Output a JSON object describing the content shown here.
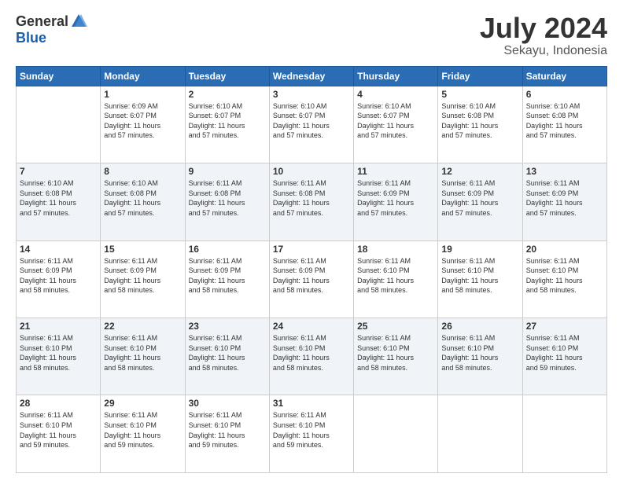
{
  "header": {
    "logo_general": "General",
    "logo_blue": "Blue",
    "month": "July 2024",
    "location": "Sekayu, Indonesia"
  },
  "days_of_week": [
    "Sunday",
    "Monday",
    "Tuesday",
    "Wednesday",
    "Thursday",
    "Friday",
    "Saturday"
  ],
  "weeks": [
    [
      {
        "day": "",
        "info": ""
      },
      {
        "day": "1",
        "info": "Sunrise: 6:09 AM\nSunset: 6:07 PM\nDaylight: 11 hours\nand 57 minutes."
      },
      {
        "day": "2",
        "info": "Sunrise: 6:10 AM\nSunset: 6:07 PM\nDaylight: 11 hours\nand 57 minutes."
      },
      {
        "day": "3",
        "info": "Sunrise: 6:10 AM\nSunset: 6:07 PM\nDaylight: 11 hours\nand 57 minutes."
      },
      {
        "day": "4",
        "info": "Sunrise: 6:10 AM\nSunset: 6:07 PM\nDaylight: 11 hours\nand 57 minutes."
      },
      {
        "day": "5",
        "info": "Sunrise: 6:10 AM\nSunset: 6:08 PM\nDaylight: 11 hours\nand 57 minutes."
      },
      {
        "day": "6",
        "info": "Sunrise: 6:10 AM\nSunset: 6:08 PM\nDaylight: 11 hours\nand 57 minutes."
      }
    ],
    [
      {
        "day": "7",
        "info": "Sunrise: 6:10 AM\nSunset: 6:08 PM\nDaylight: 11 hours\nand 57 minutes."
      },
      {
        "day": "8",
        "info": "Sunrise: 6:10 AM\nSunset: 6:08 PM\nDaylight: 11 hours\nand 57 minutes."
      },
      {
        "day": "9",
        "info": "Sunrise: 6:11 AM\nSunset: 6:08 PM\nDaylight: 11 hours\nand 57 minutes."
      },
      {
        "day": "10",
        "info": "Sunrise: 6:11 AM\nSunset: 6:08 PM\nDaylight: 11 hours\nand 57 minutes."
      },
      {
        "day": "11",
        "info": "Sunrise: 6:11 AM\nSunset: 6:09 PM\nDaylight: 11 hours\nand 57 minutes."
      },
      {
        "day": "12",
        "info": "Sunrise: 6:11 AM\nSunset: 6:09 PM\nDaylight: 11 hours\nand 57 minutes."
      },
      {
        "day": "13",
        "info": "Sunrise: 6:11 AM\nSunset: 6:09 PM\nDaylight: 11 hours\nand 57 minutes."
      }
    ],
    [
      {
        "day": "14",
        "info": "Sunrise: 6:11 AM\nSunset: 6:09 PM\nDaylight: 11 hours\nand 58 minutes."
      },
      {
        "day": "15",
        "info": "Sunrise: 6:11 AM\nSunset: 6:09 PM\nDaylight: 11 hours\nand 58 minutes."
      },
      {
        "day": "16",
        "info": "Sunrise: 6:11 AM\nSunset: 6:09 PM\nDaylight: 11 hours\nand 58 minutes."
      },
      {
        "day": "17",
        "info": "Sunrise: 6:11 AM\nSunset: 6:09 PM\nDaylight: 11 hours\nand 58 minutes."
      },
      {
        "day": "18",
        "info": "Sunrise: 6:11 AM\nSunset: 6:10 PM\nDaylight: 11 hours\nand 58 minutes."
      },
      {
        "day": "19",
        "info": "Sunrise: 6:11 AM\nSunset: 6:10 PM\nDaylight: 11 hours\nand 58 minutes."
      },
      {
        "day": "20",
        "info": "Sunrise: 6:11 AM\nSunset: 6:10 PM\nDaylight: 11 hours\nand 58 minutes."
      }
    ],
    [
      {
        "day": "21",
        "info": "Sunrise: 6:11 AM\nSunset: 6:10 PM\nDaylight: 11 hours\nand 58 minutes."
      },
      {
        "day": "22",
        "info": "Sunrise: 6:11 AM\nSunset: 6:10 PM\nDaylight: 11 hours\nand 58 minutes."
      },
      {
        "day": "23",
        "info": "Sunrise: 6:11 AM\nSunset: 6:10 PM\nDaylight: 11 hours\nand 58 minutes."
      },
      {
        "day": "24",
        "info": "Sunrise: 6:11 AM\nSunset: 6:10 PM\nDaylight: 11 hours\nand 58 minutes."
      },
      {
        "day": "25",
        "info": "Sunrise: 6:11 AM\nSunset: 6:10 PM\nDaylight: 11 hours\nand 58 minutes."
      },
      {
        "day": "26",
        "info": "Sunrise: 6:11 AM\nSunset: 6:10 PM\nDaylight: 11 hours\nand 58 minutes."
      },
      {
        "day": "27",
        "info": "Sunrise: 6:11 AM\nSunset: 6:10 PM\nDaylight: 11 hours\nand 59 minutes."
      }
    ],
    [
      {
        "day": "28",
        "info": "Sunrise: 6:11 AM\nSunset: 6:10 PM\nDaylight: 11 hours\nand 59 minutes."
      },
      {
        "day": "29",
        "info": "Sunrise: 6:11 AM\nSunset: 6:10 PM\nDaylight: 11 hours\nand 59 minutes."
      },
      {
        "day": "30",
        "info": "Sunrise: 6:11 AM\nSunset: 6:10 PM\nDaylight: 11 hours\nand 59 minutes."
      },
      {
        "day": "31",
        "info": "Sunrise: 6:11 AM\nSunset: 6:10 PM\nDaylight: 11 hours\nand 59 minutes."
      },
      {
        "day": "",
        "info": ""
      },
      {
        "day": "",
        "info": ""
      },
      {
        "day": "",
        "info": ""
      }
    ]
  ]
}
